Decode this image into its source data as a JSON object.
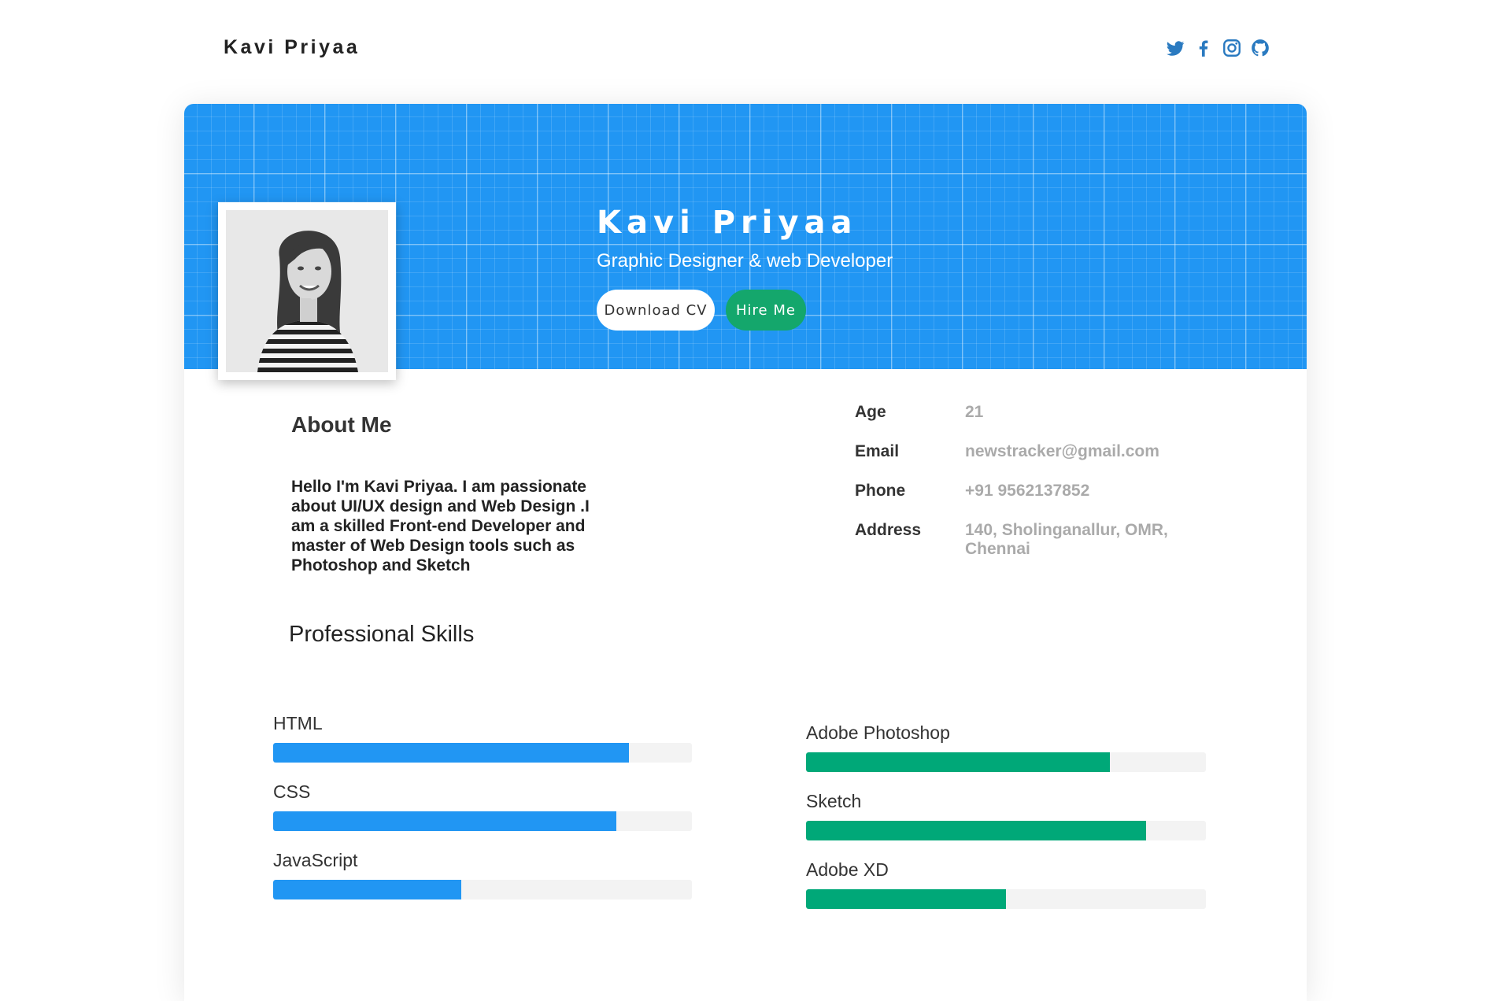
{
  "header": {
    "brand": "Kavi Priyaa",
    "socials": [
      "twitter-icon",
      "facebook-icon",
      "instagram-icon",
      "github-icon"
    ],
    "icon_color": "#2a7ac0"
  },
  "hero": {
    "name": "Kavi Priyaa",
    "subtitle": "Graphic Designer & web Developer",
    "download_label": "Download CV",
    "hire_label": "Hire Me",
    "background_color": "#2196f3",
    "hire_color": "#14a76c"
  },
  "about": {
    "title": "About Me",
    "text": "Hello I'm Kavi Priyaa. I am passionate about UI/UX design and Web Design .I am a skilled Front-end Developer and master of Web Design tools such as Photoshop and Sketch"
  },
  "info": [
    {
      "key": "Age",
      "value": "21"
    },
    {
      "key": "Email",
      "value": "newstracker@gmail.com"
    },
    {
      "key": "Phone",
      "value": "+91 9562137852"
    },
    {
      "key": "Address",
      "value": "140, Sholinganallur, OMR, Chennai"
    }
  ],
  "skills": {
    "title": "Professional Skills",
    "left_color": "#2196f3",
    "right_color": "#00a878",
    "left": [
      {
        "name": "HTML",
        "level": 85
      },
      {
        "name": "CSS",
        "level": 82
      },
      {
        "name": "JavaScript",
        "level": 45
      }
    ],
    "right": [
      {
        "name": "Adobe Photoshop",
        "level": 76
      },
      {
        "name": "Sketch",
        "level": 85
      },
      {
        "name": "Adobe XD",
        "level": 50
      }
    ]
  }
}
